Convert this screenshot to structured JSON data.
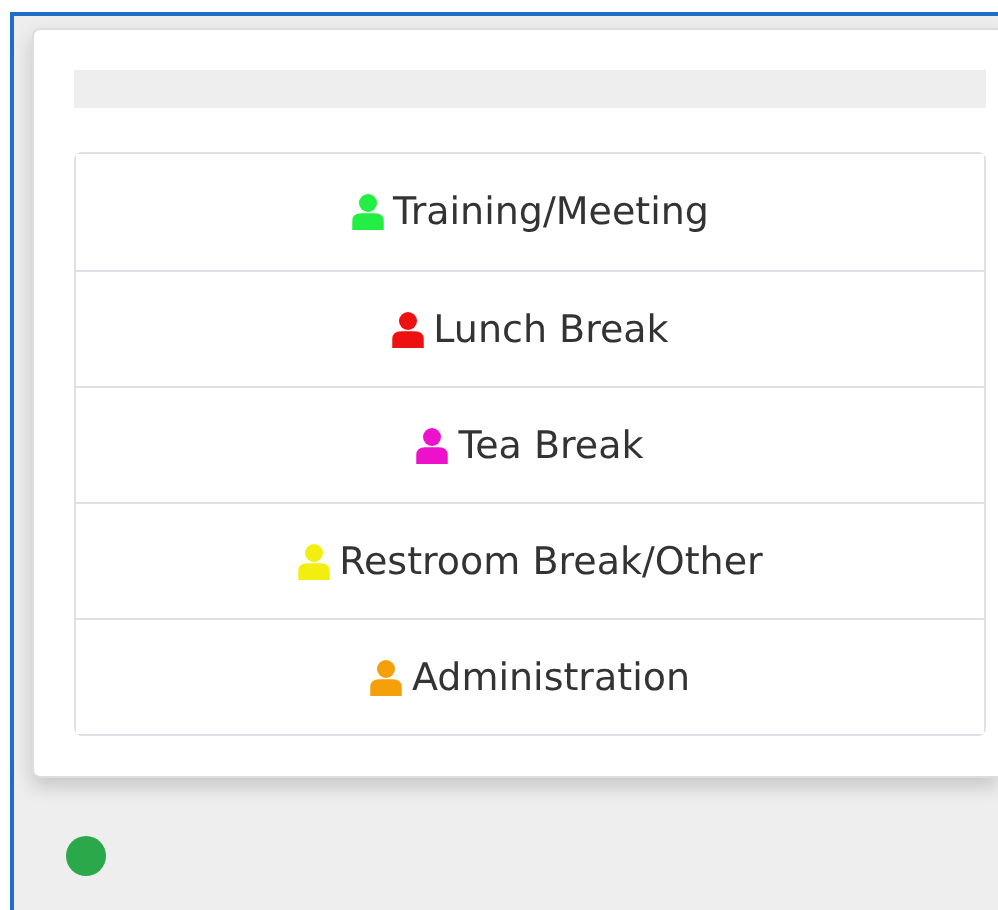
{
  "menu": {
    "items": [
      {
        "label": "Training/Meeting",
        "color": "#22ee44"
      },
      {
        "label": "Lunch Break",
        "color": "#ee1111"
      },
      {
        "label": "Tea Break",
        "color": "#ee11cc"
      },
      {
        "label": "Restroom Break/Other",
        "color": "#f2ee10"
      },
      {
        "label": "Administration",
        "color": "#f5a00a"
      }
    ]
  },
  "status": {
    "color": "#2aa84a"
  }
}
